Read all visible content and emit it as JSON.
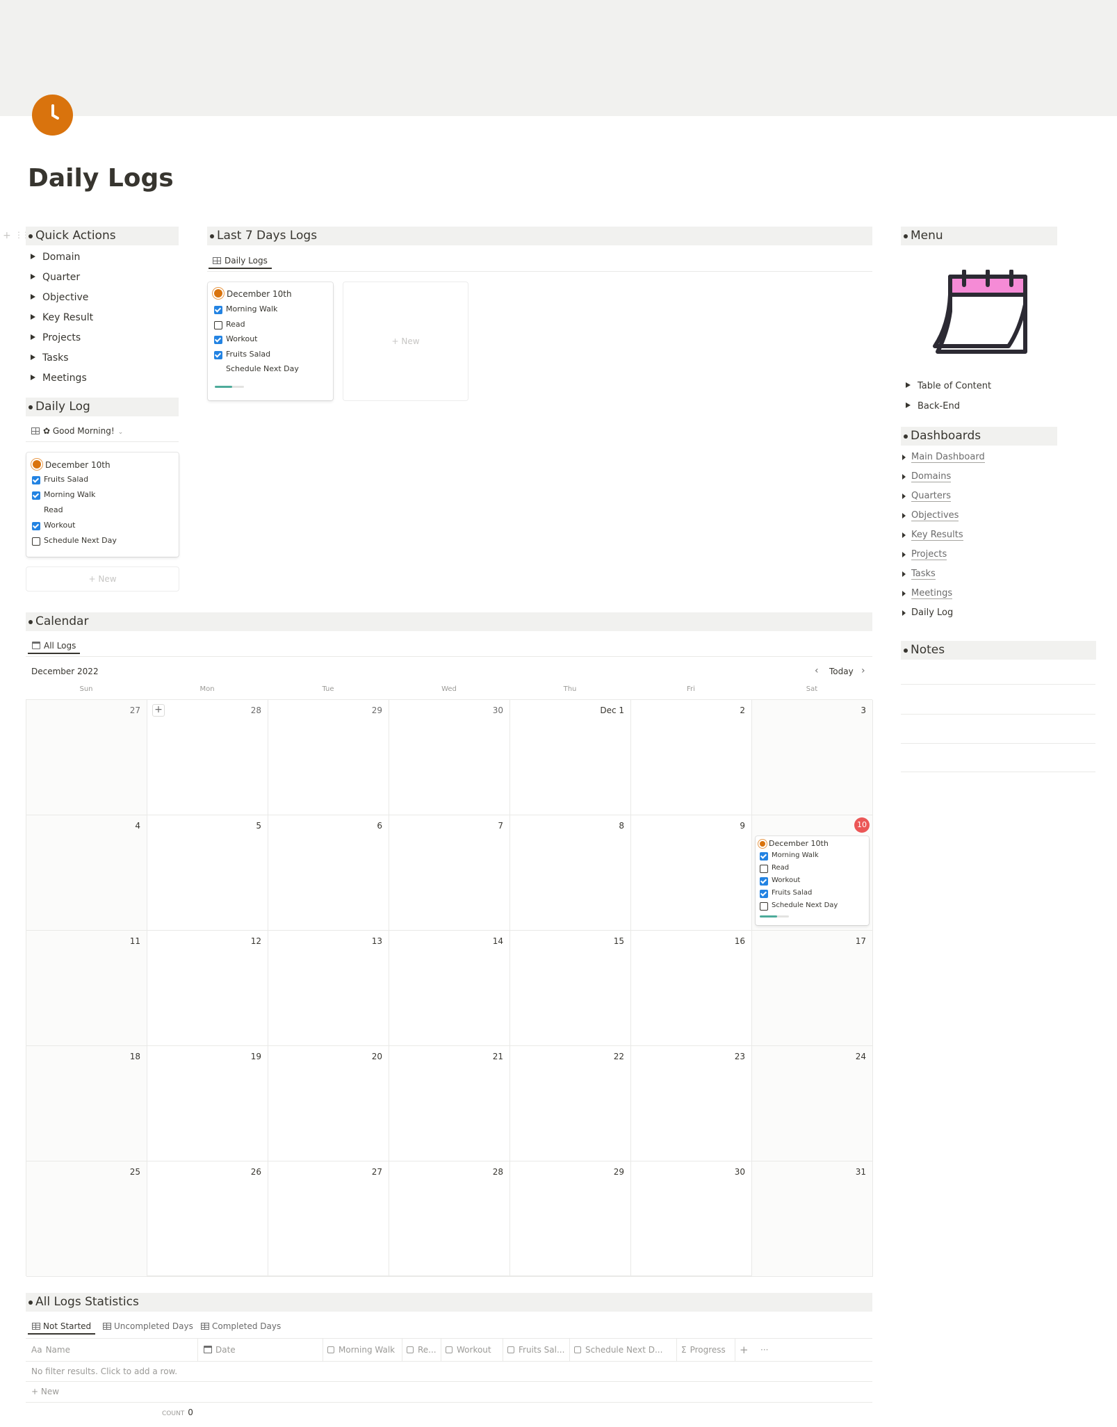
{
  "page": {
    "title": "Daily Logs",
    "icon": "clock-icon"
  },
  "quick_actions": {
    "header": "Quick Actions",
    "items": [
      "Domain",
      "Quarter",
      "Objective",
      "Key Result",
      "Projects",
      "Tasks",
      "Meetings"
    ]
  },
  "daily_log": {
    "header": "Daily Log",
    "view_label": "✿ Good Morning!",
    "card": {
      "title": "December 10th",
      "items": [
        {
          "label": "Fruits Salad",
          "state": "checked"
        },
        {
          "label": "Morning Walk",
          "state": "checked"
        },
        {
          "label": "Read",
          "state": "none"
        },
        {
          "label": "Workout",
          "state": "checked"
        },
        {
          "label": "Schedule Next Day",
          "state": "unchecked"
        }
      ]
    },
    "new_label": "+ New"
  },
  "last7": {
    "header": "Last 7 Days Logs",
    "tab": "Daily Logs",
    "card": {
      "title": "December 10th",
      "items": [
        {
          "label": "Morning Walk",
          "state": "checked"
        },
        {
          "label": "Read",
          "state": "unchecked"
        },
        {
          "label": "Workout",
          "state": "checked"
        },
        {
          "label": "Fruits Salad",
          "state": "checked"
        },
        {
          "label": "Schedule Next Day",
          "state": "none"
        }
      ],
      "progress": 0.6
    },
    "new_label": "+ New"
  },
  "menu": {
    "header": "Menu",
    "items": [
      "Table of Content",
      "Back-End"
    ]
  },
  "dashboards": {
    "header": "Dashboards",
    "items": [
      "Main Dashboard",
      "Domains",
      "Quarters",
      "Objectives",
      "Key Results",
      "Projects",
      "Tasks",
      "Meetings",
      "Daily Log"
    ]
  },
  "notes": {
    "header": "Notes"
  },
  "calendar": {
    "header": "Calendar",
    "tab": "All Logs",
    "month": "December 2022",
    "today_label": "Today",
    "weekdays": [
      "Sun",
      "Mon",
      "Tue",
      "Wed",
      "Thu",
      "Fri",
      "Sat"
    ],
    "weeks": [
      [
        "27",
        "28",
        "29",
        "30",
        "Dec 1",
        "2",
        "3"
      ],
      [
        "4",
        "5",
        "6",
        "7",
        "8",
        "9",
        "10"
      ],
      [
        "11",
        "12",
        "13",
        "14",
        "15",
        "16",
        "17"
      ],
      [
        "18",
        "19",
        "20",
        "21",
        "22",
        "23",
        "24"
      ],
      [
        "25",
        "26",
        "27",
        "28",
        "29",
        "30",
        "31"
      ]
    ],
    "event": {
      "title": "December 10th",
      "items": [
        {
          "label": "Morning Walk",
          "state": "checked"
        },
        {
          "label": "Read",
          "state": "unchecked"
        },
        {
          "label": "Workout",
          "state": "checked"
        },
        {
          "label": "Fruits Salad",
          "state": "checked"
        },
        {
          "label": "Schedule Next Day",
          "state": "unchecked"
        }
      ],
      "progress": 0.6
    }
  },
  "stats": {
    "header": "All Logs Statistics",
    "tabs": [
      "Not Started",
      "Uncompleted Days",
      "Completed Days"
    ],
    "columns": [
      "Name",
      "Date",
      "Morning Walk",
      "Re...",
      "Workout",
      "Fruits Sal...",
      "Schedule Next D...",
      "Progress"
    ],
    "name_prefix": "Aa",
    "empty": "No filter results. Click to add a row.",
    "new_label": "+ New",
    "count_label": "COUNT",
    "count_value": "0"
  }
}
